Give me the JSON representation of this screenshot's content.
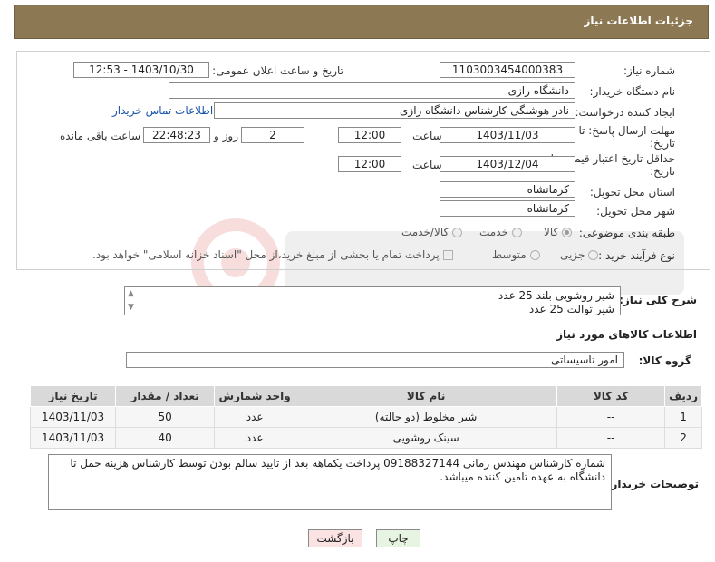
{
  "header": {
    "title": "جزئیات اطلاعات نیاز"
  },
  "need_number": {
    "label": "شماره نیاز:",
    "value": "1103003454000383"
  },
  "announce": {
    "label": "تاریخ و ساعت اعلان عمومی:",
    "value": "1403/10/30 - 12:53"
  },
  "buyer_org": {
    "label": "نام دستگاه خریدار:",
    "value": "دانشگاه رازی"
  },
  "requester": {
    "label": "ایجاد کننده درخواست:",
    "value": "نادر هوشنگی کارشناس دانشگاه رازی",
    "contact_link": "اطلاعات تماس خریدار"
  },
  "reply_deadline": {
    "label_line1": "مهلت ارسال پاسخ: تا",
    "label_line2": "تاریخ:",
    "date": "1403/11/03",
    "time_label": "ساعت",
    "time": "12:00",
    "days": "2",
    "days_label": "روز و",
    "remaining": "22:48:23",
    "remaining_label": "ساعت باقی مانده"
  },
  "price_validity": {
    "label_line1": "حداقل تاریخ اعتبار قیمت: تا",
    "label_line2": "تاریخ:",
    "date": "1403/12/04",
    "time_label": "ساعت",
    "time": "12:00"
  },
  "province": {
    "label": "استان محل تحویل:",
    "value": "کرمانشاه"
  },
  "city": {
    "label": "شهر محل تحویل:",
    "value": "کرمانشاه"
  },
  "category": {
    "label": "طبقه بندی موضوعی:",
    "options": [
      "کالا",
      "خدمت",
      "کالا/خدمت"
    ],
    "selected": "کالا"
  },
  "purchase_type": {
    "label": "نوع فرآیند خرید :",
    "options": [
      "جزیی",
      "متوسط"
    ],
    "note": "پرداخت تمام یا بخشی از مبلغ خرید،از محل \"اسناد خزانه اسلامی\" خواهد بود."
  },
  "description": {
    "label": "شرح کلی نیاز:",
    "lines": [
      "شیر روشویی بلند 25 عدد",
      "شیر توالت 25 عدد"
    ]
  },
  "goods_section": {
    "title": "اطلاعات کالاهای مورد نیاز"
  },
  "goods_group": {
    "label": "گروه کالا:",
    "value": "امور تاسیساتی"
  },
  "table": {
    "headers": [
      "ردیف",
      "کد کالا",
      "نام کالا",
      "واحد شمارش",
      "تعداد / مقدار",
      "تاریخ نیاز"
    ],
    "rows": [
      [
        "1",
        "--",
        "شیر مخلوط (دو حالته)",
        "عدد",
        "50",
        "1403/11/03"
      ],
      [
        "2",
        "--",
        "سینک روشویی",
        "عدد",
        "40",
        "1403/11/03"
      ]
    ]
  },
  "buyer_notes": {
    "label": "توضیحات خریدار:",
    "text": "شماره کارشناس مهندس زمانی  09188327144 پرداخت یکماهه بعد از تایید سالم بودن توسط کارشناس هزینه حمل تا دانشگاه به عهده تامین کننده میباشد."
  },
  "buttons": {
    "print": "چاپ",
    "back": "بازگشت"
  },
  "colors": {
    "header": "#8c7852",
    "link": "#1a55a8",
    "print_btn": "#e6f4e1",
    "back_btn": "#fbe3e3"
  }
}
